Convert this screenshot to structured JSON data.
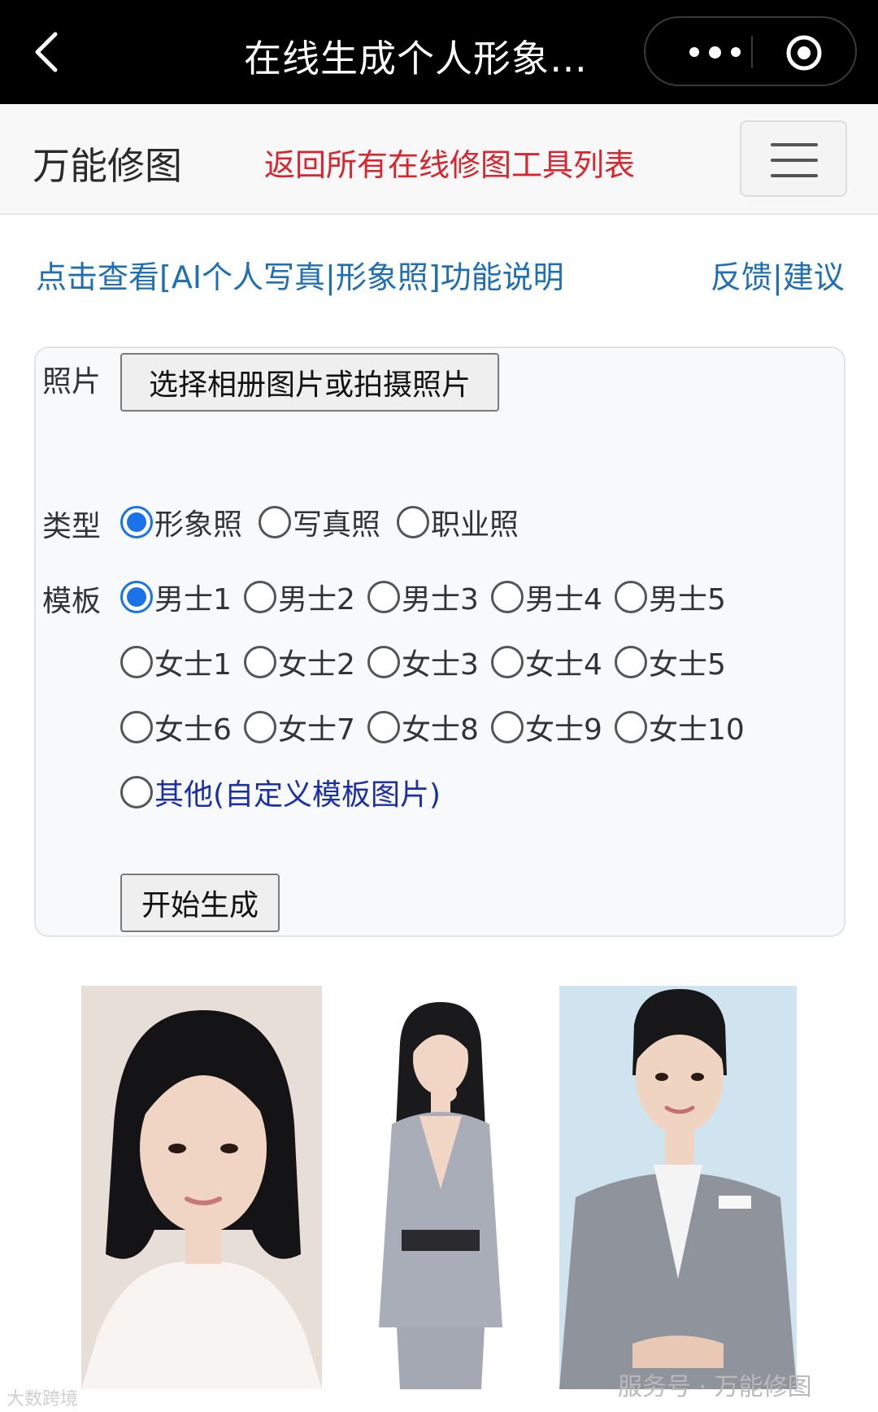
{
  "topbar": {
    "title": "在线生成个人形象…",
    "icons": [
      "back-chevron-icon",
      "more-dots-icon",
      "target-circle-icon"
    ]
  },
  "navbar": {
    "brand": "万能修图",
    "link": "返回所有在线修图工具列表",
    "menu_icon": "hamburger-icon"
  },
  "info": {
    "help_link": "点击查看[AI个人写真|形象照]功能说明",
    "feedback_link": "反馈|建议"
  },
  "form": {
    "photo_label": "照片",
    "photo_button": "选择相册图片或拍摄照片",
    "type_label": "类型",
    "types": [
      "形象照",
      "写真照",
      "职业照"
    ],
    "selected_type": "形象照",
    "template_label": "模板",
    "templates_row1": [
      "男士1",
      "男士2",
      "男士3",
      "男士4",
      "男士5"
    ],
    "templates_row2": [
      "女士1",
      "女士2",
      "女士3",
      "女士4",
      "女士5"
    ],
    "templates_row3": [
      "女士6",
      "女士7",
      "女士8",
      "女士9",
      "女士10"
    ],
    "template_custom": "其他(自定义模板图片)",
    "selected_template": "男士1",
    "submit_button": "开始生成"
  },
  "gallery": {
    "images": [
      "sample-portrait-white-shirt",
      "sample-portrait-grey-suit-full",
      "sample-portrait-grey-suit-badge"
    ]
  },
  "watermarks": {
    "left": "大数跨境",
    "right": "服务号 · 万能修图"
  }
}
